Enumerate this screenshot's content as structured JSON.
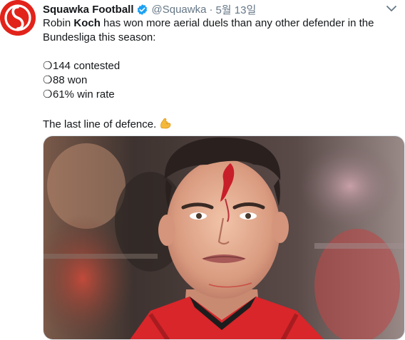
{
  "account": {
    "display_name": "Squawka Football",
    "handle": "@Squawka",
    "separator": "·",
    "timestamp": "5월 13일",
    "verified": true,
    "avatar_icon": "squawka-logo-icon",
    "brand_color": "#e2231a"
  },
  "tweet": {
    "text_before_bold": "Robin ",
    "bold_name": "Koch",
    "text_after_bold": " has won more aerial duels than any other defender in the",
    "text_line2": "Bundesliga this season:",
    "stats": [
      {
        "bullet": "❍",
        "text": "144 contested"
      },
      {
        "bullet": "❍",
        "text": "88 won"
      },
      {
        "bullet": "❍",
        "text": "61% win rate"
      }
    ],
    "closing": "The last line of defence.",
    "closing_emoji": "flexed-biceps-emoji"
  },
  "media": {
    "type": "photo",
    "subject": "player-photo"
  },
  "colors": {
    "text": "#14171a",
    "muted": "#657786",
    "verified_blue": "#1da1f2",
    "border": "#e1e8ed"
  }
}
